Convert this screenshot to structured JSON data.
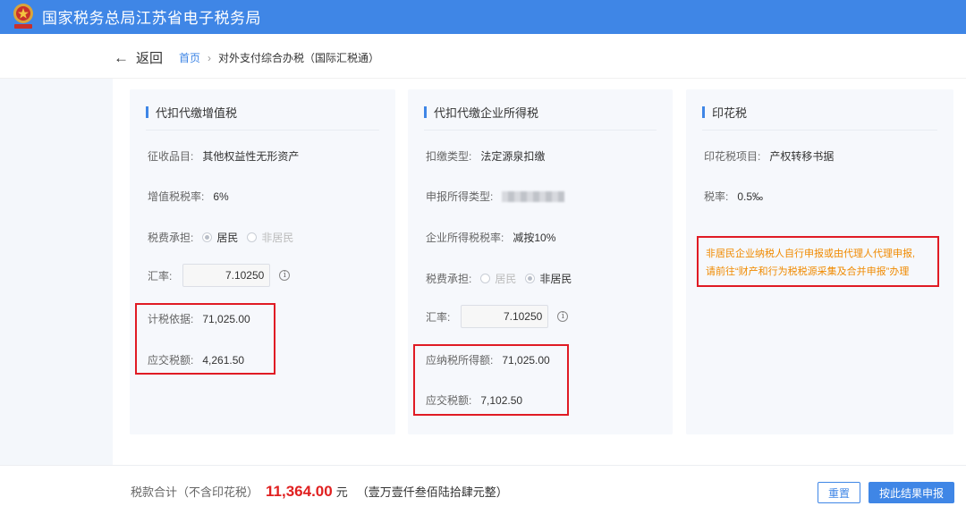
{
  "header": {
    "title": "国家税务总局江苏省电子税务局"
  },
  "nav": {
    "back_label": "返回",
    "breadcrumb_home": "首页",
    "breadcrumb_sep": "›",
    "breadcrumb_current": "对外支付综合办税（国际汇税通）"
  },
  "vat": {
    "title": "代扣代缴增值税",
    "item_label": "征收品目:",
    "item_value": "其他权益性无形资产",
    "rate_label": "增值税税率:",
    "rate_value": "6%",
    "bearer_label": "税费承担:",
    "bearer_option1": "居民",
    "bearer_option2": "非居民",
    "fx_label": "汇率:",
    "fx_value": "7.10250",
    "basis_label": "计税依据:",
    "basis_value": "71,025.00",
    "tax_label": "应交税额:",
    "tax_value": "4,261.50"
  },
  "cit": {
    "title": "代扣代缴企业所得税",
    "type_label": "扣缴类型:",
    "type_value": "法定源泉扣缴",
    "income_type_label": "申报所得类型:",
    "rate_label": "企业所得税税率:",
    "rate_value": "减按10%",
    "bearer_label": "税费承担:",
    "bearer_option1": "居民",
    "bearer_option2": "非居民",
    "fx_label": "汇率:",
    "fx_value": "7.10250",
    "taxable_label": "应纳税所得额:",
    "taxable_value": "71,025.00",
    "tax_label": "应交税额:",
    "tax_value": "7,102.50"
  },
  "stamp": {
    "title": "印花税",
    "item_label": "印花税项目:",
    "item_value": "产权转移书据",
    "rate_label": "税率:",
    "rate_value": "0.5‰",
    "notice_line1": "非居民企业纳税人自行申报或由代理人代理申报,",
    "notice_line2": "请前往“财产和行为税税源采集及合并申报”办理"
  },
  "footer": {
    "total_label": "税款合计（不含印花税）",
    "total_amount": "11,364.00",
    "total_unit": "元",
    "total_words": "（壹万壹仟叁佰陆拾肆元整）",
    "reset_label": "重置",
    "submit_label": "按此结果申报"
  },
  "colors": {
    "brand": "#3f86e6",
    "highlight": "#e01b24",
    "notice": "#f08a00",
    "amount": "#e02020"
  }
}
